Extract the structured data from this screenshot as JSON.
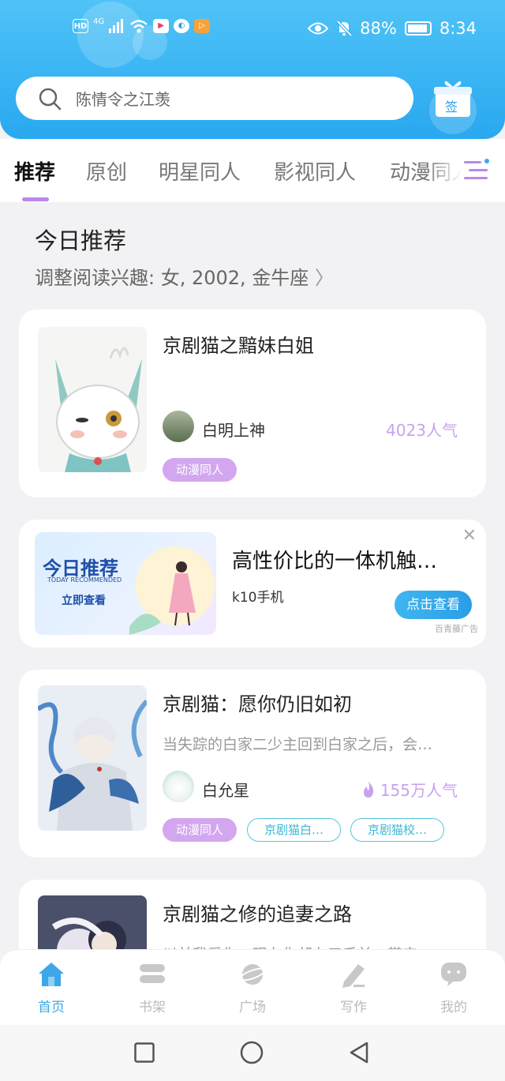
{
  "status_bar": {
    "hd": "HD",
    "network": "4G",
    "battery": "88%",
    "time": "8:34"
  },
  "search": {
    "placeholder": "陈情令之江羡"
  },
  "sign_in": {
    "label": "签"
  },
  "tabs": [
    {
      "label": "推荐",
      "active": true
    },
    {
      "label": "原创"
    },
    {
      "label": "明星同人"
    },
    {
      "label": "影视同人"
    },
    {
      "label": "动漫同人"
    }
  ],
  "section": {
    "title": "今日推荐",
    "subtitle": "调整阅读兴趣: 女, 2002, 金牛座"
  },
  "books": [
    {
      "title": "京剧猫之黯妹白姐",
      "author": "白明上神",
      "popularity": "4023人气",
      "tags": [
        "动漫同人"
      ]
    },
    {
      "title": "京剧猫：愿你仍旧如初",
      "desc": "当失踪的白家二少主回到白家之后，会…",
      "author": "白允星",
      "popularity": "155万人气",
      "tags": [
        "动漫同人",
        "京剧猫白…",
        "京剧猫校…"
      ]
    },
    {
      "title": "京剧猫之修的追妻之路",
      "desc": "以前我爱你，现在你却在三千前，带来"
    }
  ],
  "ad": {
    "image_title": "今日推荐",
    "image_subtitle": "TODAY RECOMMENDED",
    "image_cta": "立即查看",
    "title": "高性价比的一体机触…",
    "subtitle": "k10手机",
    "button": "点击查看",
    "source": "百青藤广告"
  },
  "bottom_nav": [
    {
      "label": "首页",
      "icon": "home-icon",
      "active": true
    },
    {
      "label": "书架",
      "icon": "bookshelf-icon"
    },
    {
      "label": "广场",
      "icon": "planet-icon"
    },
    {
      "label": "写作",
      "icon": "pen-icon"
    },
    {
      "label": "我的",
      "icon": "chat-bubble-icon"
    }
  ],
  "colors": {
    "header": "#29a8f0",
    "accent_purple": "#d3a7ef",
    "accent_blue": "#3ea7e8"
  }
}
